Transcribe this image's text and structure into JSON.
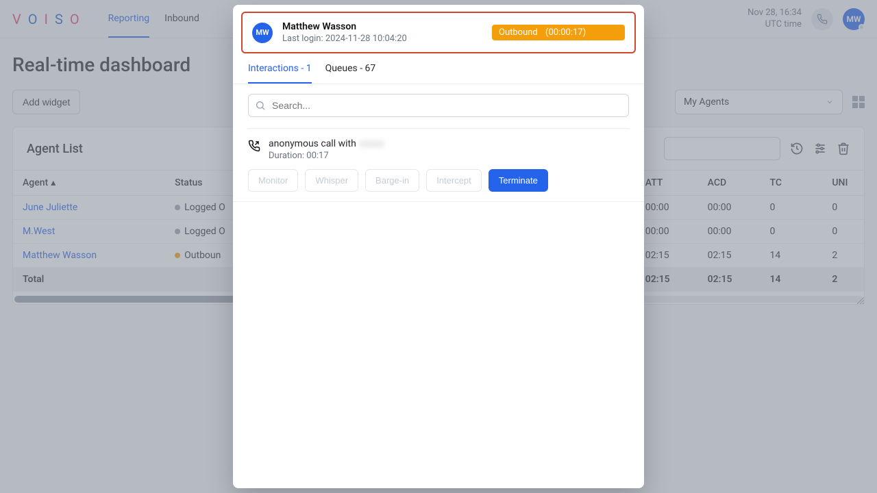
{
  "header": {
    "logo_letters": [
      "V",
      "O",
      "I",
      "S",
      "O"
    ],
    "nav": [
      {
        "label": "Reporting",
        "active": true
      },
      {
        "label": "Inbound",
        "active": false
      }
    ],
    "time_line1": "Nov 28, 16:34",
    "time_line2": "UTC time",
    "avatar_initials": "MW"
  },
  "page": {
    "title": "Real-time dashboard",
    "add_widget_label": "Add widget",
    "my_agents_label": "My Agents"
  },
  "widget": {
    "title": "Agent List",
    "columns": {
      "agent": "Agent",
      "status": "Status",
      "att": "ATT",
      "acd": "ACD",
      "tc": "TC",
      "uni": "UNI"
    },
    "rows": [
      {
        "agent": "June Juliette",
        "status_label": "Logged O",
        "dot": "grey",
        "att": "00:00",
        "acd": "00:00",
        "tc": "0",
        "uni": "0"
      },
      {
        "agent": "M.West",
        "status_label": "Logged O",
        "dot": "grey",
        "att": "00:00",
        "acd": "00:00",
        "tc": "0",
        "uni": "0"
      },
      {
        "agent": "Matthew Wasson",
        "status_label": "Outboun",
        "dot": "orange",
        "att": "02:15",
        "acd": "02:15",
        "tc": "14",
        "uni": "2"
      }
    ],
    "total": {
      "label": "Total",
      "att": "02:15",
      "acd": "02:15",
      "tc": "14",
      "uni": "2"
    }
  },
  "modal": {
    "avatar_initials": "MW",
    "name": "Matthew Wasson",
    "last_login": "Last login: 2024-11-28 10:04:20",
    "status_text": "Outbound",
    "status_timer": "(00:00:17)",
    "tabs": {
      "interactions": "Interactions - 1",
      "queues": "Queues - 67"
    },
    "search_placeholder": "Search...",
    "interaction": {
      "title": "anonymous call with",
      "blurred": "xxxx",
      "duration": "Duration: 00:17",
      "actions": {
        "monitor": "Monitor",
        "whisper": "Whisper",
        "barge": "Barge-in",
        "intercept": "Intercept",
        "terminate": "Terminate"
      }
    }
  }
}
